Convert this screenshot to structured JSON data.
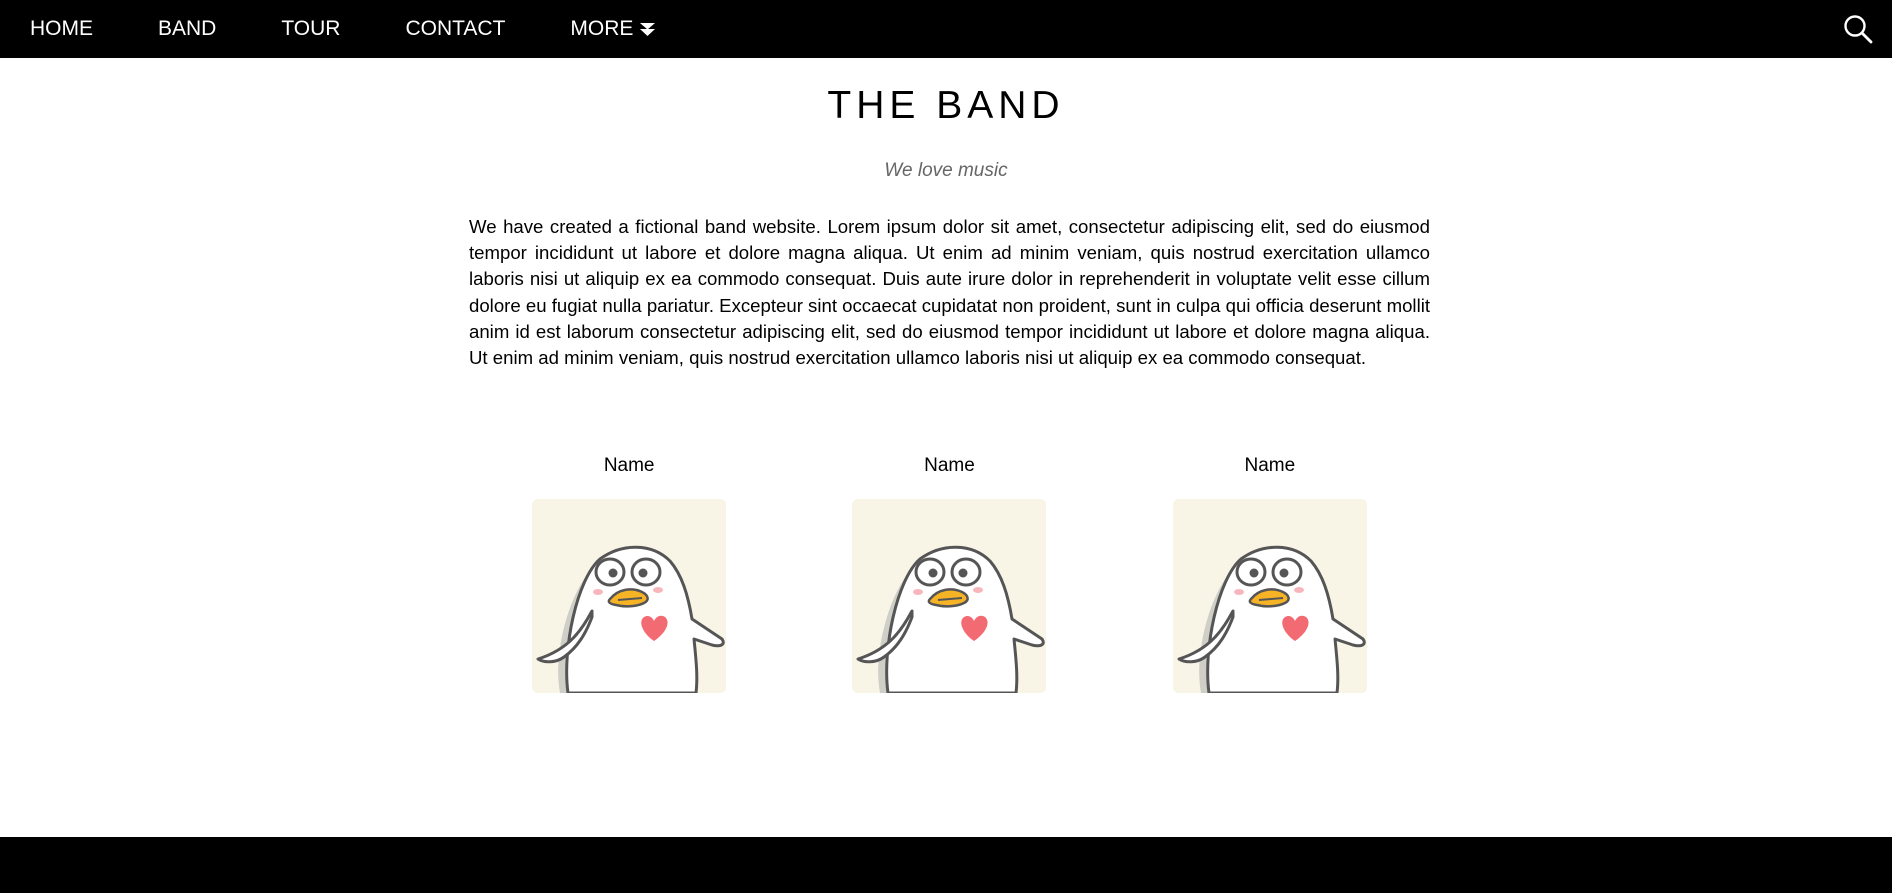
{
  "nav": {
    "items": [
      {
        "label": "HOME"
      },
      {
        "label": "BAND"
      },
      {
        "label": "TOUR"
      },
      {
        "label": "CONTACT"
      },
      {
        "label": "MORE"
      }
    ],
    "more_icon": "caret-down-icon",
    "search_icon": "search-icon"
  },
  "main": {
    "title": "THE BAND",
    "subtitle": "We love music",
    "description": "We have created a fictional band website. Lorem ipsum dolor sit amet, consectetur adipiscing elit, sed do eiusmod tempor incididunt ut labore et dolore magna aliqua. Ut enim ad minim veniam, quis nostrud exercitation ullamco laboris nisi ut aliquip ex ea commodo consequat. Duis aute irure dolor in reprehenderit in voluptate velit esse cillum dolore eu fugiat nulla pariatur. Excepteur sint occaecat cupidatat non proident, sunt in culpa qui officia deserunt mollit anim id est laborum consectetur adipiscing elit, sed do eiusmod tempor incididunt ut labore et dolore magna aliqua. Ut enim ad minim veniam, quis nostrud exercitation ullamco laboris nisi ut aliquip ex ea commodo consequat.",
    "members": [
      {
        "name": "Name",
        "image": "penguin-avatar"
      },
      {
        "name": "Name",
        "image": "penguin-avatar"
      },
      {
        "name": "Name",
        "image": "penguin-avatar"
      }
    ]
  },
  "colors": {
    "nav_bg": "#000000",
    "avatar_bg": "#f8f5e6",
    "heart": "#f26b72",
    "beak": "#f5b325"
  }
}
